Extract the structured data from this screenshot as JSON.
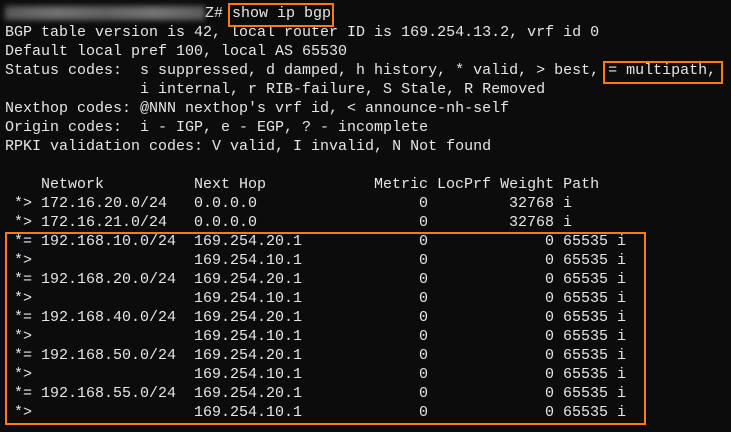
{
  "prompt": {
    "host_suffix": "Z#",
    "command": "show ip bgp"
  },
  "info_lines": [
    "BGP table version is 42, local router ID is 169.254.13.2, vrf id 0",
    "Default local pref 100, local AS 65530",
    "Status codes:  s suppressed, d damped, h history, * valid, > best, ",
    "               i internal, r RIB-failure, S Stale, R Removed",
    "Nexthop codes: @NNN nexthop's vrf id, < announce-nh-self",
    "Origin codes:  i - IGP, e - EGP, ? - incomplete",
    "RPKI validation codes: V valid, I invalid, N Not found"
  ],
  "multipath_code": "= multipath,",
  "table": {
    "headers": {
      "network": "Network",
      "next_hop": "Next Hop",
      "metric": "Metric",
      "locprf": "LocPrf",
      "weight": "Weight",
      "path": "Path"
    },
    "rows": [
      {
        "status": "*>",
        "network": "172.16.20.0/24",
        "next_hop": "0.0.0.0",
        "metric": "0",
        "locprf": "",
        "weight": "32768",
        "path": "i"
      },
      {
        "status": "*>",
        "network": "172.16.21.0/24",
        "next_hop": "0.0.0.0",
        "metric": "0",
        "locprf": "",
        "weight": "32768",
        "path": "i"
      },
      {
        "status": "*=",
        "network": "192.168.10.0/24",
        "next_hop": "169.254.20.1",
        "metric": "0",
        "locprf": "",
        "weight": "0",
        "path": "65535 i"
      },
      {
        "status": "*>",
        "network": "",
        "next_hop": "169.254.10.1",
        "metric": "0",
        "locprf": "",
        "weight": "0",
        "path": "65535 i"
      },
      {
        "status": "*=",
        "network": "192.168.20.0/24",
        "next_hop": "169.254.20.1",
        "metric": "0",
        "locprf": "",
        "weight": "0",
        "path": "65535 i"
      },
      {
        "status": "*>",
        "network": "",
        "next_hop": "169.254.10.1",
        "metric": "0",
        "locprf": "",
        "weight": "0",
        "path": "65535 i"
      },
      {
        "status": "*=",
        "network": "192.168.40.0/24",
        "next_hop": "169.254.20.1",
        "metric": "0",
        "locprf": "",
        "weight": "0",
        "path": "65535 i"
      },
      {
        "status": "*>",
        "network": "",
        "next_hop": "169.254.10.1",
        "metric": "0",
        "locprf": "",
        "weight": "0",
        "path": "65535 i"
      },
      {
        "status": "*=",
        "network": "192.168.50.0/24",
        "next_hop": "169.254.20.1",
        "metric": "0",
        "locprf": "",
        "weight": "0",
        "path": "65535 i"
      },
      {
        "status": "*>",
        "network": "",
        "next_hop": "169.254.10.1",
        "metric": "0",
        "locprf": "",
        "weight": "0",
        "path": "65535 i"
      },
      {
        "status": "*=",
        "network": "192.168.55.0/24",
        "next_hop": "169.254.20.1",
        "metric": "0",
        "locprf": "",
        "weight": "0",
        "path": "65535 i"
      },
      {
        "status": "*>",
        "network": "",
        "next_hop": "169.254.10.1",
        "metric": "0",
        "locprf": "",
        "weight": "0",
        "path": "65535 i"
      }
    ]
  },
  "colors": {
    "background": "#0c0c0c",
    "text": "#e6e6e6",
    "highlight": "#ff7a0f"
  }
}
